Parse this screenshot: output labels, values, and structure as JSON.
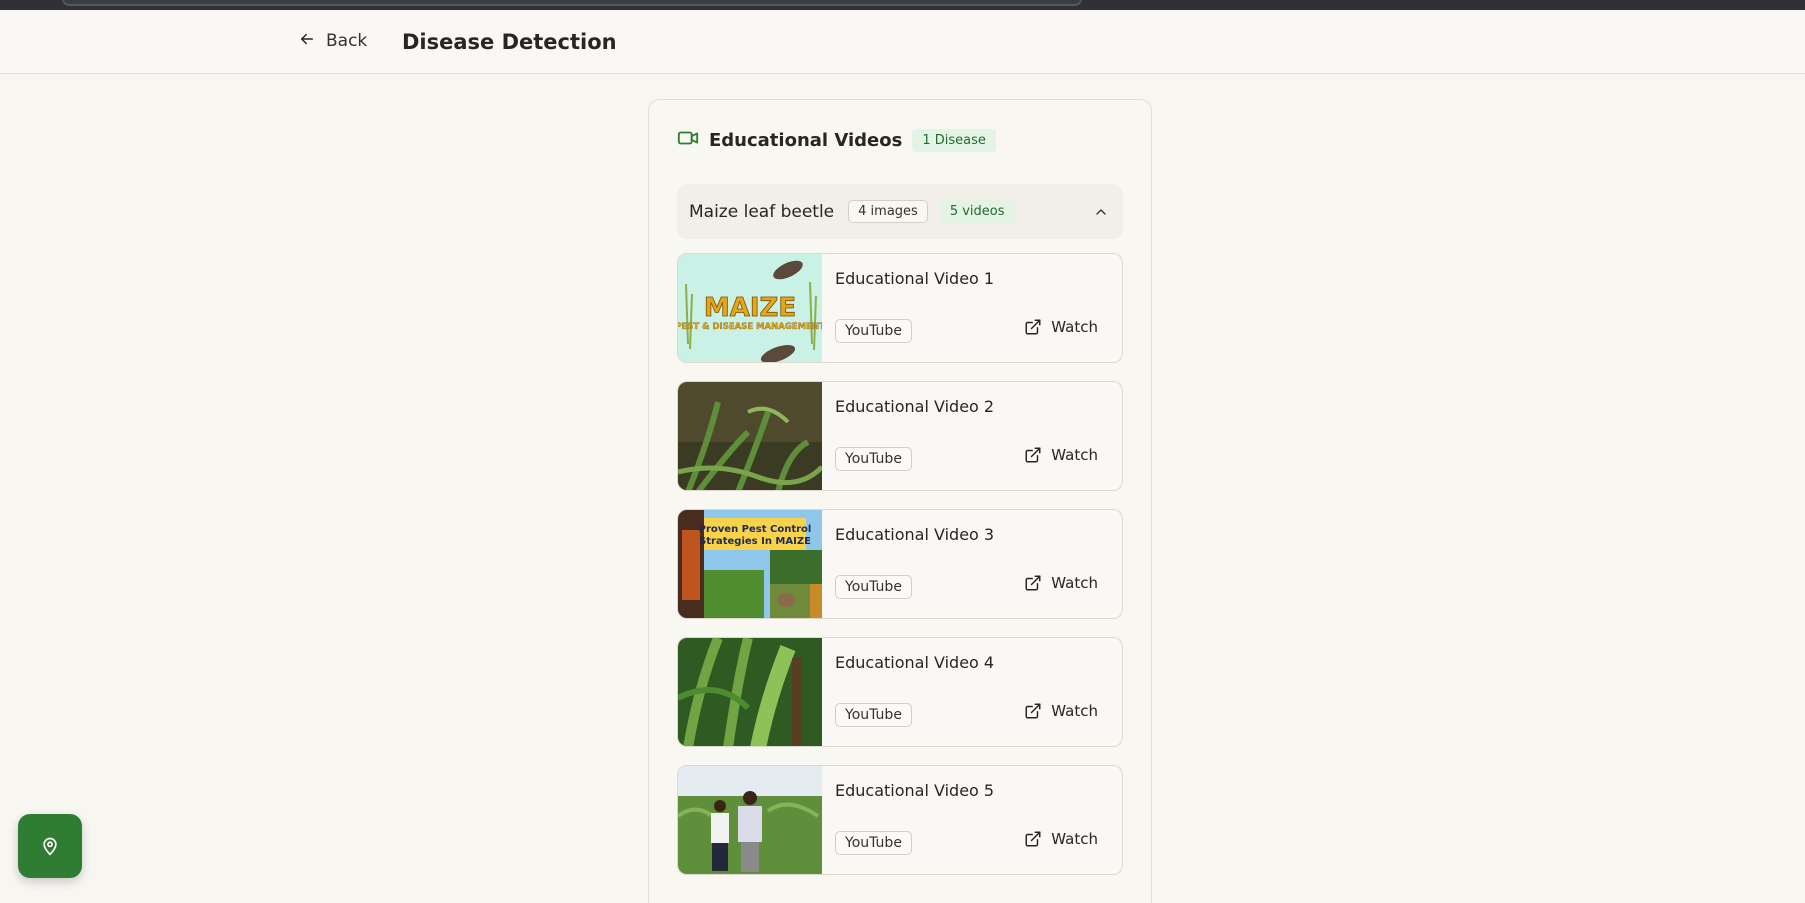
{
  "header": {
    "back_label": "Back",
    "title": "Disease Detection"
  },
  "panel": {
    "heading": "Educational Videos",
    "disease_count": "1 Disease",
    "disease": {
      "name": "Maize leaf beetle",
      "images_count": "4 images",
      "videos_count": "5 videos"
    },
    "videos": [
      {
        "title": "Educational Video 1",
        "source": "YouTube",
        "action": "Watch",
        "thumb_text_1": "MAIZE",
        "thumb_text_2": "PEST & DISEASE MANAGEMENT"
      },
      {
        "title": "Educational Video 2",
        "source": "YouTube",
        "action": "Watch"
      },
      {
        "title": "Educational Video 3",
        "source": "YouTube",
        "action": "Watch",
        "thumb_text_1": "Proven Pest  Control",
        "thumb_text_2": "Strategies In MAIZE"
      },
      {
        "title": "Educational Video 4",
        "source": "YouTube",
        "action": "Watch"
      },
      {
        "title": "Educational Video 5",
        "source": "YouTube",
        "action": "Watch"
      }
    ]
  },
  "icons": {
    "back": "arrow-left-icon",
    "video": "video-camera-icon",
    "collapse": "chevron-up-icon",
    "watch": "external-link-icon",
    "location": "map-pin-icon"
  },
  "colors": {
    "accent_green": "#2e7d32",
    "badge_green_bg": "#e3f3e4",
    "badge_green_text": "#246b32",
    "background": "#f8f6f1"
  }
}
